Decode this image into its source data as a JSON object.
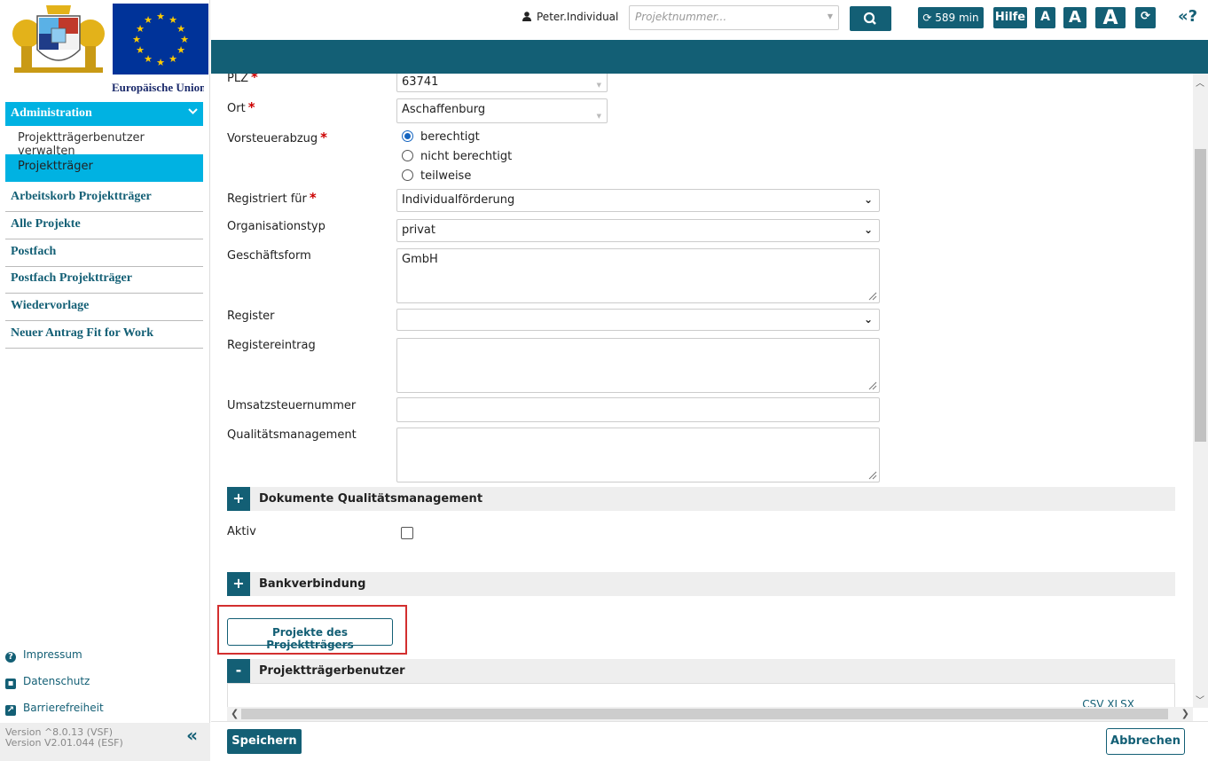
{
  "sidebar": {
    "eu_caption": "Europäische Union",
    "admin_label": "Administration",
    "admin_subitems": [
      "Projektträgerbenutzer verwalten",
      "Projektträger"
    ],
    "nav_items": [
      "Arbeitskorb Projektträger",
      "Alle Projekte",
      "Postfach",
      "Postfach Projektträger",
      "Wiedervorlage",
      "Neuer Antrag Fit for Work"
    ],
    "footer_links": [
      "Impressum",
      "Datenschutz",
      "Barrierefreiheit"
    ],
    "version_lines": [
      "Version ^8.0.13 (VSF)",
      "Version V2.01.044 (ESF)"
    ]
  },
  "topbar": {
    "user": "Peter.Individual",
    "search_placeholder": "Projektnummer...",
    "session": "589 min",
    "help": "Hilfe",
    "font_small": "A",
    "font_medium": "A",
    "font_large": "A",
    "help_toggle": "«?"
  },
  "form": {
    "plz": {
      "label": "PLZ",
      "value": "63741"
    },
    "ort": {
      "label": "Ort",
      "value": "Aschaffenburg"
    },
    "vorsteuer": {
      "label": "Vorsteuerabzug",
      "options": [
        "berechtigt",
        "nicht berechtigt",
        "teilweise"
      ],
      "selected": "berechtigt"
    },
    "registriert": {
      "label": "Registriert für",
      "value": "Individualförderung"
    },
    "orgtyp": {
      "label": "Organisationstyp",
      "value": "privat"
    },
    "geschaeftsform": {
      "label": "Geschäftsform",
      "value": "GmbH"
    },
    "register": {
      "label": "Register",
      "value": ""
    },
    "registereintrag": {
      "label": "Registereintrag",
      "value": ""
    },
    "ust": {
      "label": "Umsatzsteuernummer",
      "value": ""
    },
    "qm": {
      "label": "Qualitätsmanagement",
      "value": ""
    },
    "dok_qm_section": {
      "toggle": "+",
      "title": "Dokumente Qualitätsmanagement"
    },
    "aktiv": {
      "label": "Aktiv",
      "checked": false
    },
    "bank_section": {
      "toggle": "+",
      "title": "Bankverbindung"
    },
    "projekte_button": "Projekte des Projektträgers",
    "benutzer_section": {
      "toggle": "-",
      "title": "Projektträgerbenutzer"
    },
    "export_links": "CSV  XLSX"
  },
  "bottombar": {
    "save": "Speichern",
    "cancel": "Abbrechen"
  },
  "colors": {
    "primary": "#135f75",
    "accent": "#00b2e2",
    "required": "#cc0000",
    "highlight_frame": "#d32f2f"
  }
}
